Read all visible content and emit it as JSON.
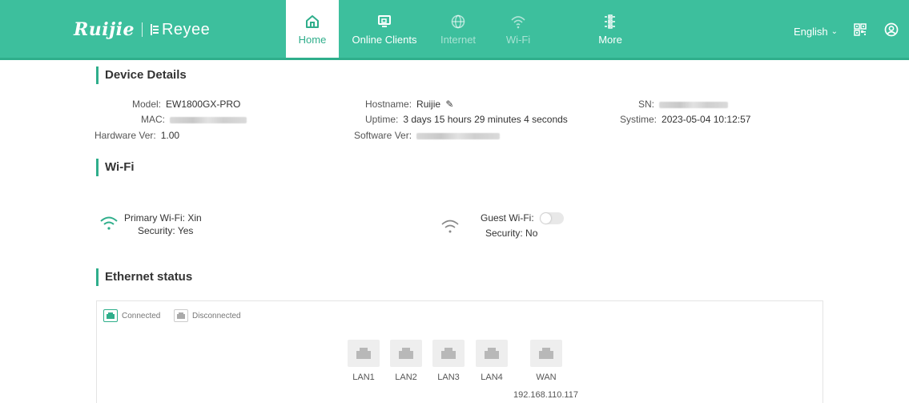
{
  "header": {
    "brand": "Ruijie",
    "sub_brand": "Reyee",
    "language": "English",
    "accent_color": "#3dbf9d",
    "nav": [
      {
        "label": "Home",
        "icon": "home-icon",
        "state": "active"
      },
      {
        "label": "Online Clients",
        "icon": "monitor-icon",
        "state": "normal"
      },
      {
        "label": "Internet",
        "icon": "globe-icon",
        "state": "disabled"
      },
      {
        "label": "Wi-Fi",
        "icon": "wifi-icon",
        "state": "disabled"
      },
      {
        "label": "More",
        "icon": "sliders-icon",
        "state": "normal"
      }
    ]
  },
  "device_details": {
    "title": "Device Details",
    "model_label": "Model:",
    "model": "EW1800GX-PRO",
    "mac_label": "MAC:",
    "hardware_label": "Hardware Ver:",
    "hardware": "1.00",
    "hostname_label": "Hostname:",
    "hostname": "Ruijie",
    "uptime_label": "Uptime:",
    "uptime": "3 days 15 hours 29 minutes 4 seconds",
    "software_label": "Software Ver:",
    "sn_label": "SN:",
    "systime_label": "Systime:",
    "systime": "2023-05-04 10:12:57"
  },
  "wifi": {
    "title": "Wi-Fi",
    "primary_label": "Primary Wi-Fi:",
    "primary_ssid": "Xin",
    "primary_security_label": "Security:",
    "primary_security": "Yes",
    "guest_label": "Guest Wi-Fi:",
    "guest_enabled": false,
    "guest_security_label": "Security:",
    "guest_security": "No"
  },
  "ethernet": {
    "title": "Ethernet status",
    "legend_connected": "Connected",
    "legend_disconnected": "Disconnected",
    "ports": [
      "LAN1",
      "LAN2",
      "LAN3",
      "LAN4",
      "WAN"
    ],
    "wan_ip": "192.168.110.117"
  }
}
